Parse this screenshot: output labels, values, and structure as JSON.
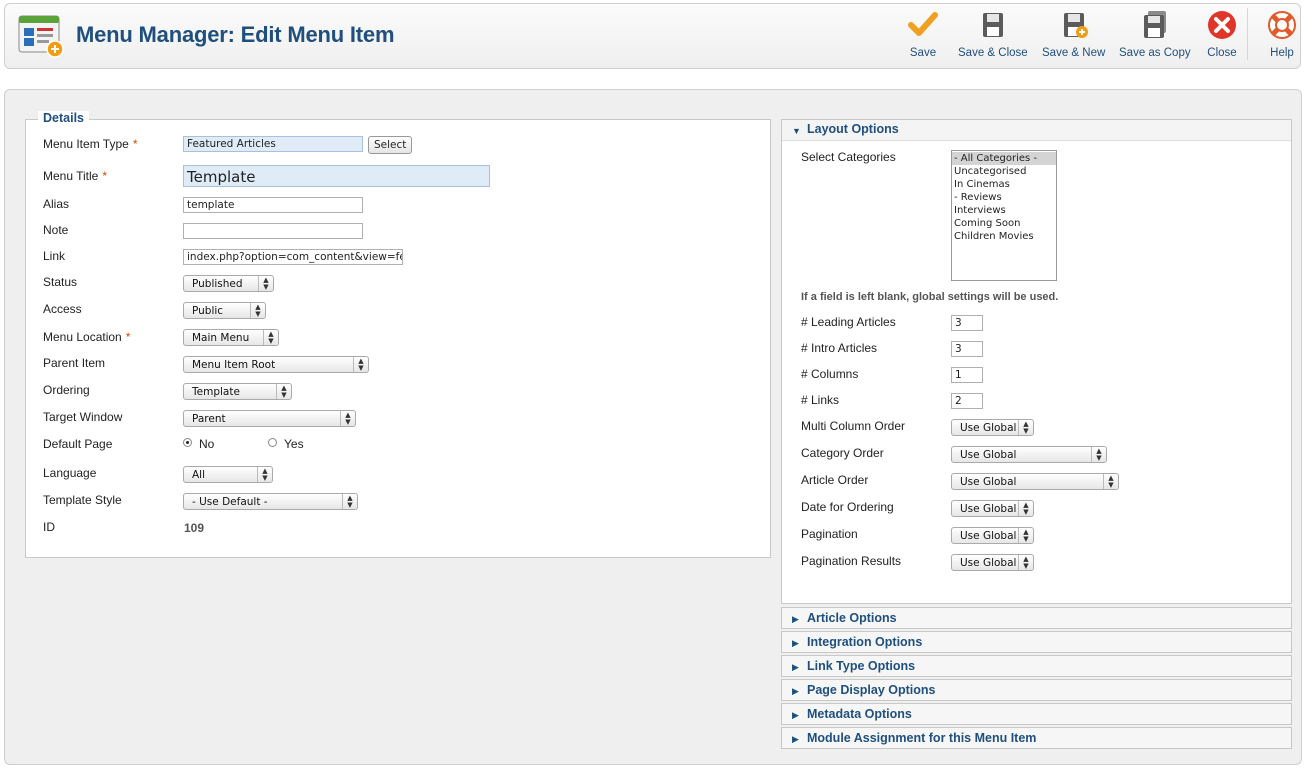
{
  "header": {
    "title": "Menu Manager: Edit Menu Item",
    "toolbar": [
      {
        "label": "Save",
        "icon": "check-icon"
      },
      {
        "label": "Save & Close",
        "icon": "disk-icon"
      },
      {
        "label": "Save & New",
        "icon": "disk-plus-icon"
      },
      {
        "label": "Save as Copy",
        "icon": "disk-copy-icon"
      },
      {
        "label": "Close",
        "icon": "close-icon"
      },
      {
        "label": "Help",
        "icon": "lifebuoy-icon"
      }
    ]
  },
  "details": {
    "legend": "Details",
    "menu_item_type": {
      "label": "Menu Item Type",
      "value": "Featured Articles",
      "button": "Select"
    },
    "menu_title": {
      "label": "Menu Title",
      "value": "Template"
    },
    "alias": {
      "label": "Alias",
      "value": "template"
    },
    "note": {
      "label": "Note",
      "value": ""
    },
    "link": {
      "label": "Link",
      "value": "index.php?option=com_content&view=featu"
    },
    "status": {
      "label": "Status",
      "value": "Published"
    },
    "access": {
      "label": "Access",
      "value": "Public"
    },
    "menu_location": {
      "label": "Menu Location",
      "value": "Main Menu"
    },
    "parent_item": {
      "label": "Parent Item",
      "value": "Menu Item Root"
    },
    "ordering": {
      "label": "Ordering",
      "value": "Template"
    },
    "target_window": {
      "label": "Target Window",
      "value": "Parent"
    },
    "default_page": {
      "label": "Default Page",
      "options": [
        "No",
        "Yes"
      ],
      "selected": "No"
    },
    "language": {
      "label": "Language",
      "value": "All"
    },
    "template_style": {
      "label": "Template Style",
      "value": "- Use Default -"
    },
    "id": {
      "label": "ID",
      "value": "109"
    },
    "required_marker": "*"
  },
  "layout_options": {
    "title": "Layout Options",
    "select_categories": {
      "label": "Select Categories",
      "items": [
        "- All Categories -",
        "Uncategorised",
        "In Cinemas",
        "- Reviews",
        "Interviews",
        "Coming Soon",
        "Children Movies"
      ],
      "selected": "- All Categories -"
    },
    "note": "If a field is left blank, global settings will be used.",
    "leading_articles": {
      "label": "# Leading Articles",
      "value": "3"
    },
    "intro_articles": {
      "label": "# Intro Articles",
      "value": "3"
    },
    "columns": {
      "label": "# Columns",
      "value": "1"
    },
    "links": {
      "label": "# Links",
      "value": "2"
    },
    "multi_column_order": {
      "label": "Multi Column Order",
      "value": "Use Global"
    },
    "category_order": {
      "label": "Category Order",
      "value": "Use Global"
    },
    "article_order": {
      "label": "Article Order",
      "value": "Use Global"
    },
    "date_for_ordering": {
      "label": "Date for Ordering",
      "value": "Use Global"
    },
    "pagination": {
      "label": "Pagination",
      "value": "Use Global"
    },
    "pagination_results": {
      "label": "Pagination Results",
      "value": "Use Global"
    }
  },
  "collapsed_panels": [
    "Article Options",
    "Integration Options",
    "Link Type Options",
    "Page Display Options",
    "Metadata Options",
    "Module Assignment for this Menu Item"
  ],
  "colors": {
    "accent": "#1f4f7d",
    "required": "#d04a02",
    "highlight_field": "#dfecf8"
  }
}
